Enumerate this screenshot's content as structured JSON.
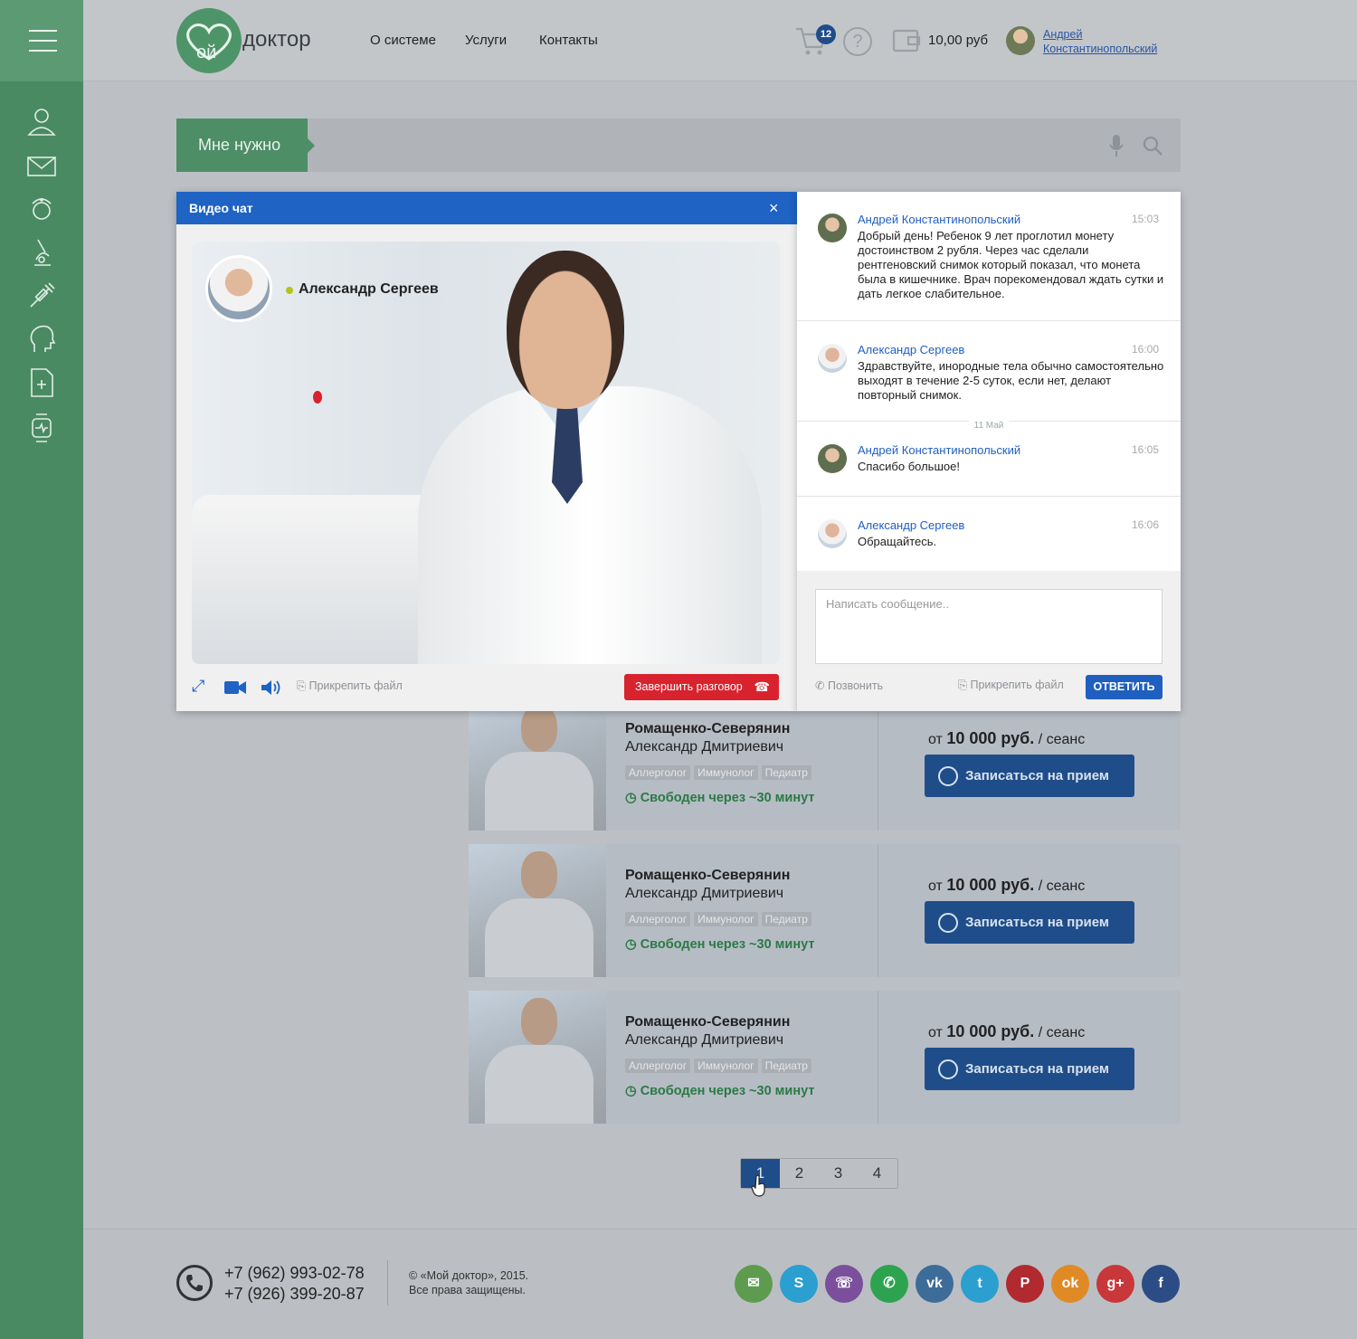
{
  "header": {
    "logo_text": "доктор",
    "logo_mark": "ой",
    "nav": [
      "О системе",
      "Услуги",
      "Контакты"
    ],
    "cart_count": "12",
    "help": "?",
    "balance": "10,00 руб",
    "user_first": "Андрей",
    "user_last": "Константинопольский"
  },
  "sidebar": {
    "icons": [
      "user-icon",
      "mail-icon",
      "nurse-icon",
      "microscope-icon",
      "syringe-icon",
      "head-icon",
      "document-icon",
      "smartwatch-icon"
    ]
  },
  "search": {
    "label": "Мне нужно"
  },
  "video_chat": {
    "title": "Видео чат",
    "close": "×",
    "caller_name": "Александр Сергеев",
    "attach_label": "Прикрепить файл",
    "end_call_label": "Завершить разговор"
  },
  "chat": {
    "messages": [
      {
        "author": "Андрей Константинопольский",
        "time": "15:03",
        "text": "Добрый день! Ребенок 9 лет проглотил монету достоинством 2 рубля. Через час сделали рентгеновский снимок который показал, что монета была в кишечнике. Врач порекомендовал ждать сутки и дать легкое слабительное."
      },
      {
        "author": "Александр Сергеев",
        "time": "16:00",
        "text": "Здравствуйте, инородные тела обычно самостоятельно выходят в течение 2-5 суток, если нет, делают повторный снимок."
      },
      {
        "author": "Андрей Константинопольский",
        "time": "16:05",
        "text": "Спасибо большое!"
      },
      {
        "author": "Александр Сергеев",
        "time": "16:06",
        "text": "Обращайтесь."
      }
    ],
    "date_separator": "11 Май",
    "input_placeholder": "Написать сообщение..",
    "call_label": "Позвонить",
    "attach_label": "Прикрепить файл",
    "reply_label": "ОТВЕТИТЬ"
  },
  "doctors": [
    {
      "surname": "Ромащенко-Северянин",
      "name": "Александр Дмитриевич",
      "tags": [
        "Аллерголог",
        "Иммунолог",
        "Педиатр"
      ],
      "availability": "Свободен через ~30 минут",
      "price_prefix": "от",
      "price": "10 000 руб.",
      "price_suffix": "/ сеанс",
      "book_label": "Записаться на прием"
    },
    {
      "surname": "Ромащенко-Северянин",
      "name": "Александр Дмитриевич",
      "tags": [
        "Аллерголог",
        "Иммунолог",
        "Педиатр"
      ],
      "availability": "Свободен через ~30 минут",
      "price_prefix": "от",
      "price": "10 000 руб.",
      "price_suffix": "/ сеанс",
      "book_label": "Записаться на прием"
    },
    {
      "surname": "Ромащенко-Северянин",
      "name": "Александр Дмитриевич",
      "tags": [
        "Аллерголог",
        "Иммунолог",
        "Педиатр"
      ],
      "availability": "Свободен через ~30 минут",
      "price_prefix": "от",
      "price": "10 000 руб.",
      "price_suffix": "/ сеанс",
      "book_label": "Записаться на прием"
    }
  ],
  "pagination": {
    "pages": [
      "1",
      "2",
      "3",
      "4"
    ],
    "current": "1"
  },
  "footer": {
    "phone1": "+7 (962) 993-02-78",
    "phone2": "+7 (926) 399-20-87",
    "copyright1": "© «Мой доктор», 2015.",
    "copyright2": "Все права защищены.",
    "social": [
      {
        "icon": "email-icon",
        "glyph": "✉",
        "color": "#5e9b4f"
      },
      {
        "icon": "skype-icon",
        "glyph": "S",
        "color": "#2a9fd0"
      },
      {
        "icon": "viber-icon",
        "glyph": "☏",
        "color": "#7b4f9c"
      },
      {
        "icon": "whatsapp-icon",
        "glyph": "✆",
        "color": "#2ea34f"
      },
      {
        "icon": "vk-icon",
        "glyph": "vk",
        "color": "#3d6c98"
      },
      {
        "icon": "twitter-icon",
        "glyph": "t",
        "color": "#2a9fd0"
      },
      {
        "icon": "pinterest-icon",
        "glyph": "P",
        "color": "#b02a2f"
      },
      {
        "icon": "odnoklassniki-icon",
        "glyph": "ok",
        "color": "#e08a26"
      },
      {
        "icon": "googleplus-icon",
        "glyph": "g+",
        "color": "#c8373a"
      },
      {
        "icon": "facebook-icon",
        "glyph": "f",
        "color": "#2b4c85"
      }
    ]
  }
}
